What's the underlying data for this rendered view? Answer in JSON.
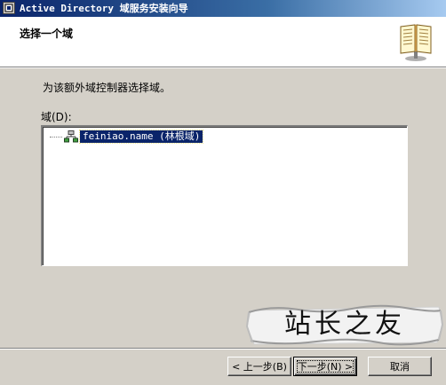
{
  "window": {
    "title": "Active Directory 域服务安装向导"
  },
  "header": {
    "title": "选择一个域",
    "icon": "book-icon"
  },
  "main": {
    "instruction": "为该额外域控制器选择域。",
    "domain_label": "域(D):",
    "tree": {
      "items": [
        {
          "label": "feiniao.name (林根域)",
          "icon": "domain-tree-icon",
          "selected": true
        }
      ]
    }
  },
  "watermark": {
    "text": "站长之友"
  },
  "buttons": {
    "back": "< 上一步(B)",
    "next": "下一步(N) >",
    "cancel": "取消"
  },
  "colors": {
    "titlebar_start": "#0a246a",
    "titlebar_end": "#a6caf0",
    "dialog_bg": "#d4d0c8",
    "selection_bg": "#0a246a"
  }
}
